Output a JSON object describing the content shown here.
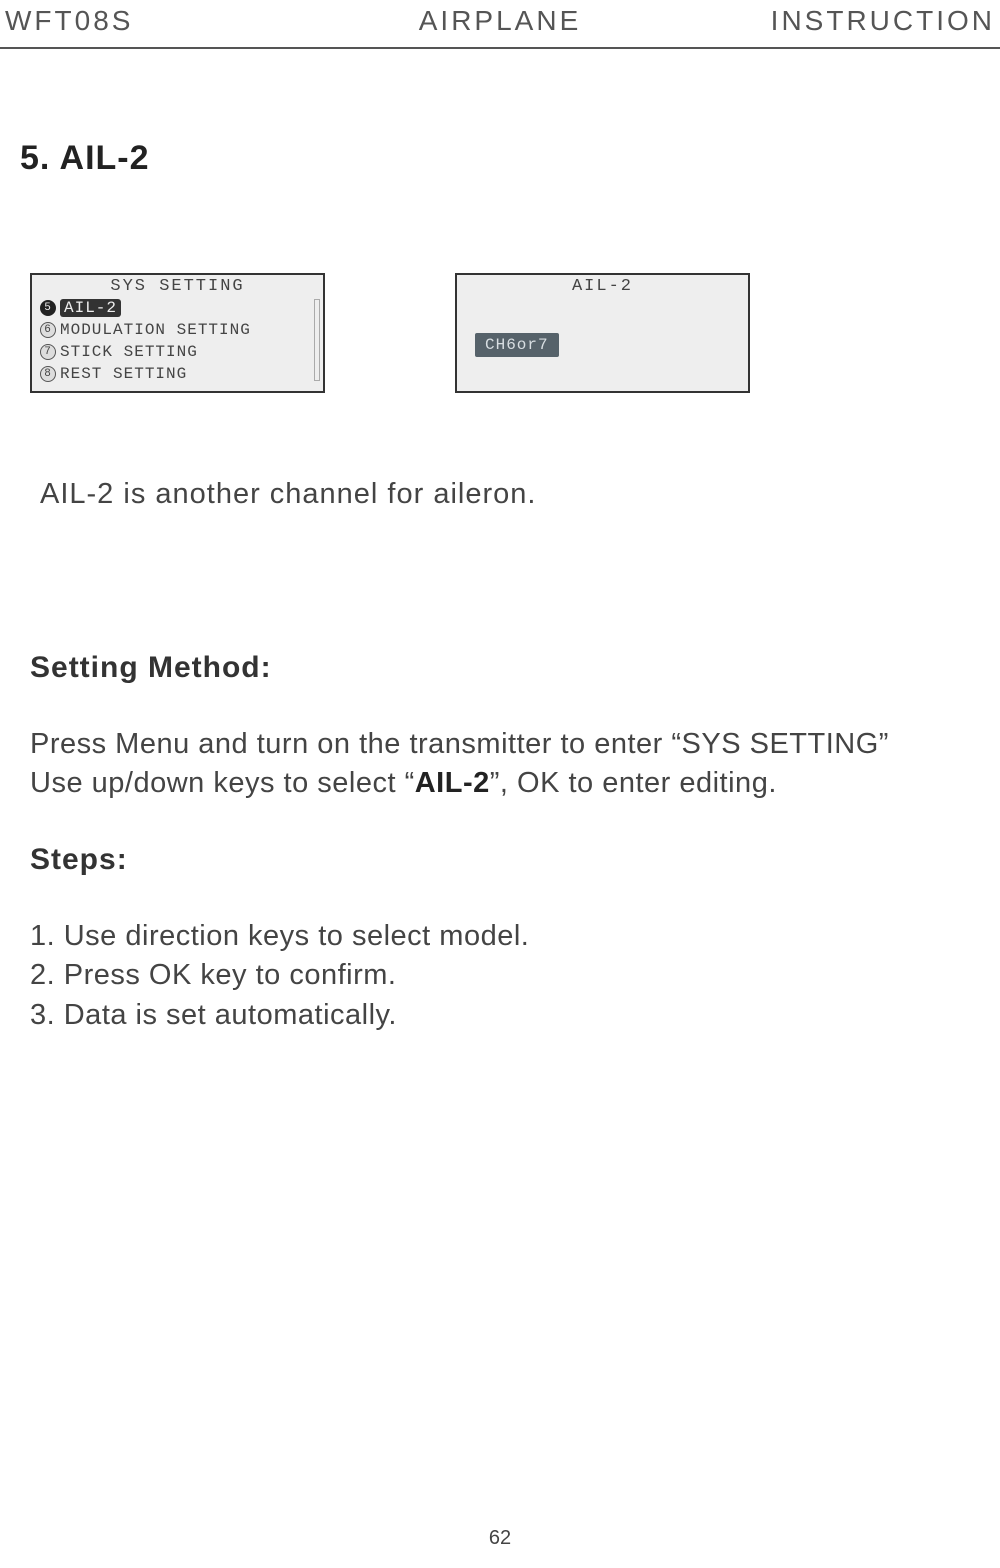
{
  "header": {
    "left": "WFT08S",
    "center": "AIRPLANE",
    "right": "INSTRUCTION"
  },
  "section_title": "5. AIL-2",
  "screen1": {
    "title": "SYS SETTING",
    "rows": [
      {
        "num": "5",
        "label": "AIL-2",
        "selected": true
      },
      {
        "num": "6",
        "label": "MODULATION SETTING",
        "selected": false
      },
      {
        "num": "7",
        "label": "STICK SETTING",
        "selected": false
      },
      {
        "num": "8",
        "label": "REST SETTING",
        "selected": false
      }
    ]
  },
  "screen2": {
    "title": "AIL-2",
    "button": "CH6or7"
  },
  "description": "AIL-2 is another channel for aileron.",
  "method_title": "Setting Method:",
  "method_line1_a": "Press Menu and turn on the transmitter to enter “SYS SETTING”",
  "method_line2_a": "Use up/down keys to select “",
  "method_line2_bold": "AIL-2",
  "method_line2_b": "”, OK to enter editing.",
  "steps_title": "Steps:",
  "steps": {
    "s1": "1. Use direction keys to select model.",
    "s2": "2. Press OK key to confirm.",
    "s3": "3.  Data is set automatically."
  },
  "page_number": "62"
}
